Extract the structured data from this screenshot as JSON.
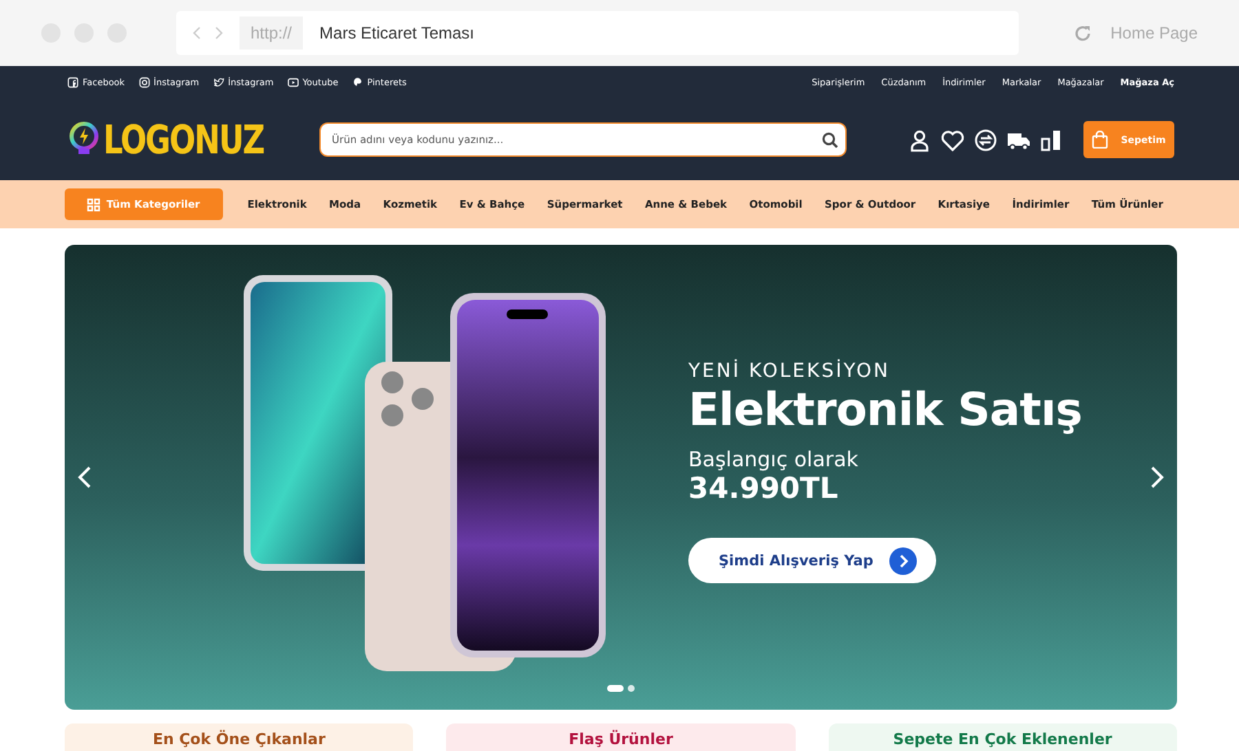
{
  "browser": {
    "scheme": "http://",
    "address": "Mars Eticaret Teması",
    "home": "Home Page"
  },
  "social_links": [
    {
      "kind": "facebook",
      "label": "Facebook"
    },
    {
      "kind": "instagram",
      "label": "İnstagram"
    },
    {
      "kind": "twitter",
      "label": "İnstagram"
    },
    {
      "kind": "youtube",
      "label": "Youtube"
    },
    {
      "kind": "pinterest",
      "label": "Pinterets"
    }
  ],
  "account_links": [
    {
      "label": "Siparişlerim",
      "bold": false
    },
    {
      "label": "Cüzdanım",
      "bold": false
    },
    {
      "label": "İndirimler",
      "bold": false
    },
    {
      "label": "Markalar",
      "bold": false
    },
    {
      "label": "Mağazalar",
      "bold": false
    },
    {
      "label": "Mağaza Aç",
      "bold": true
    }
  ],
  "logo": {
    "text": "LOGONUZ"
  },
  "search": {
    "placeholder": "Ürün adını veya kodunu yazınız..."
  },
  "cart": {
    "label": "Sepetim"
  },
  "categories_button": {
    "label": "Tüm Kategoriler"
  },
  "nav_items": [
    "Elektronik",
    "Moda",
    "Kozmetik",
    "Ev & Bahçe",
    "Süpermarket",
    "Anne & Bebek",
    "Otomobil",
    "Spor & Outdoor",
    "Kırtasiye",
    "İndirimler",
    "Tüm Ürünler"
  ],
  "hero": {
    "eyebrow": "YENİ KOLEKSİYON",
    "title": "Elektronik Satış",
    "subtitle": "Başlangıç olarak",
    "price": "34.990TL",
    "button": "Şimdi Alışveriş Yap",
    "dots": [
      {
        "selected": true
      },
      {
        "selected": false
      }
    ]
  },
  "sections": [
    {
      "title": "En Çok Öne Çıkanlar",
      "color": "#a4501a"
    },
    {
      "title": "Flaş Ürünler",
      "color": "#b3123e"
    },
    {
      "title": "Sepete En Çok Eklenenler",
      "color": "#137a4a"
    }
  ]
}
